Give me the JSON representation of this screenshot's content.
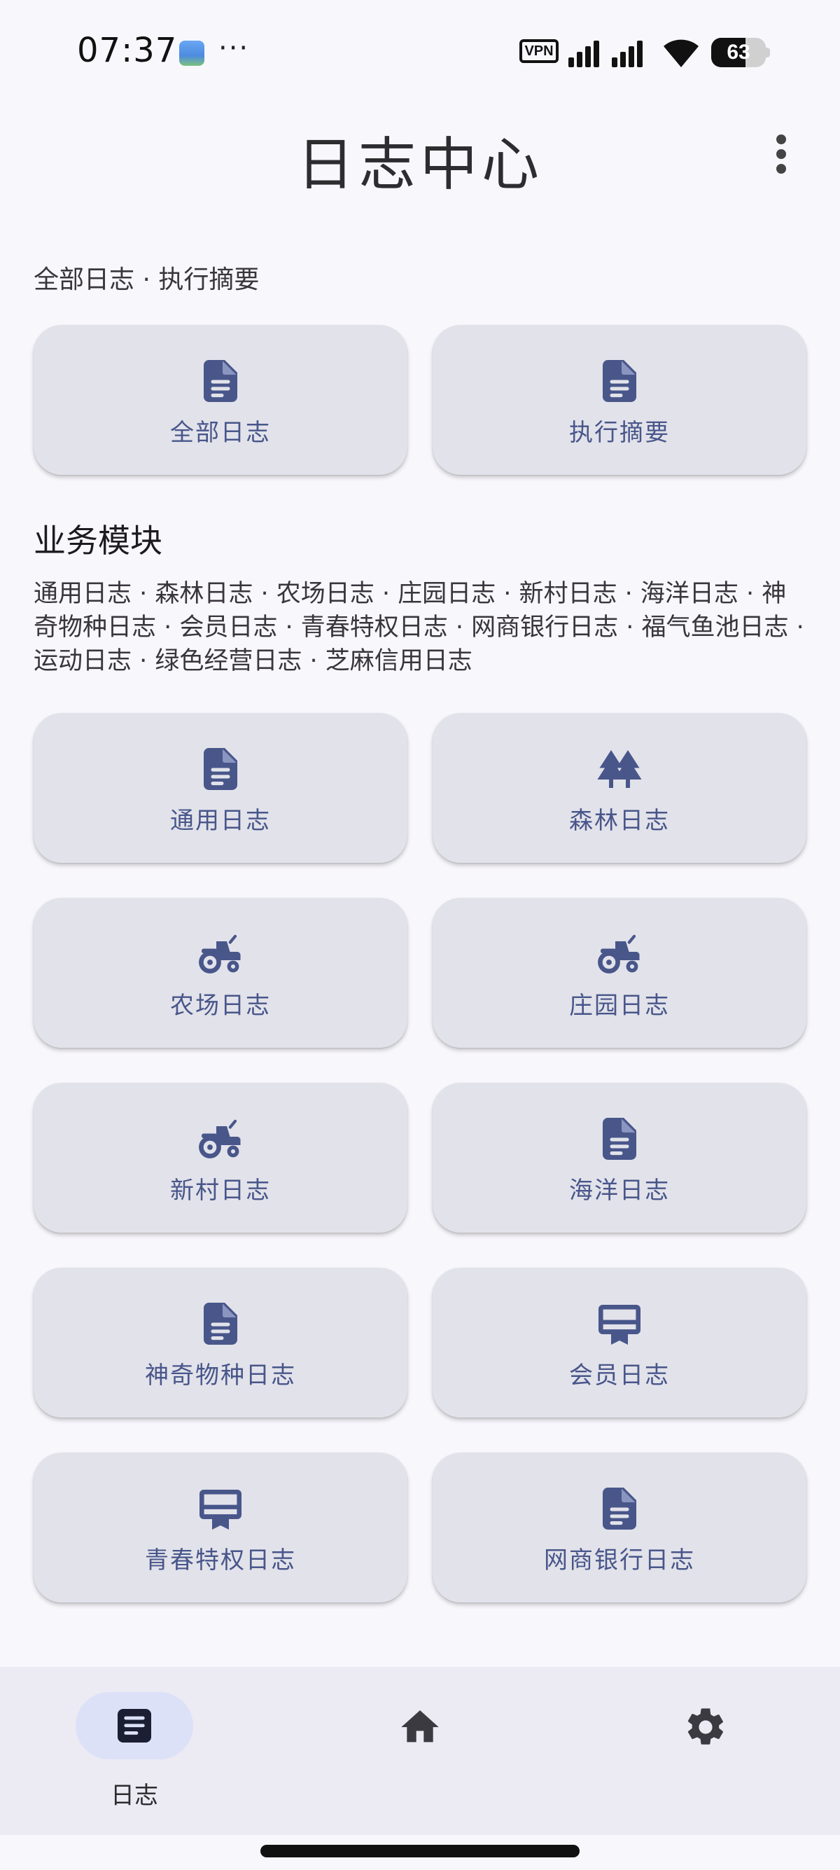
{
  "status_bar": {
    "time": "07:37",
    "more": "···",
    "vpn": "VPN",
    "battery_percent": 63
  },
  "app_bar": {
    "title": "日志中心"
  },
  "summary": {
    "line": "全部日志 · 执行摘要",
    "cards": [
      {
        "label": "全部日志",
        "icon": "document-icon"
      },
      {
        "label": "执行摘要",
        "icon": "document-icon"
      }
    ]
  },
  "modules": {
    "title": "业务模块",
    "list_text": "通用日志 · 森林日志 · 农场日志 · 庄园日志 · 新村日志 · 海洋日志 · 神奇物种日志 · 会员日志 · 青春特权日志 · 网商银行日志 · 福气鱼池日志 · 运动日志 · 绿色经营日志 · 芝麻信用日志",
    "cards": [
      {
        "label": "通用日志",
        "icon": "document-icon"
      },
      {
        "label": "森林日志",
        "icon": "forest-icon"
      },
      {
        "label": "农场日志",
        "icon": "tractor-icon"
      },
      {
        "label": "庄园日志",
        "icon": "tractor-icon"
      },
      {
        "label": "新村日志",
        "icon": "tractor-icon"
      },
      {
        "label": "海洋日志",
        "icon": "document-icon"
      },
      {
        "label": "神奇物种日志",
        "icon": "document-icon"
      },
      {
        "label": "会员日志",
        "icon": "card-membership-icon"
      },
      {
        "label": "青春特权日志",
        "icon": "card-membership-icon"
      },
      {
        "label": "网商银行日志",
        "icon": "document-icon"
      }
    ]
  },
  "bottom_nav": {
    "items": [
      {
        "label": "日志",
        "icon": "article-icon",
        "selected": true
      },
      {
        "label": "",
        "icon": "home-icon",
        "selected": false
      },
      {
        "label": "",
        "icon": "settings-icon",
        "selected": false
      }
    ]
  },
  "colors": {
    "accent": "#48568a",
    "card_bg": "#e2e2ea",
    "page_bg": "#f8f7fc",
    "nav_bg": "#eceaf3",
    "nav_selected_pill": "#dce1f8"
  }
}
